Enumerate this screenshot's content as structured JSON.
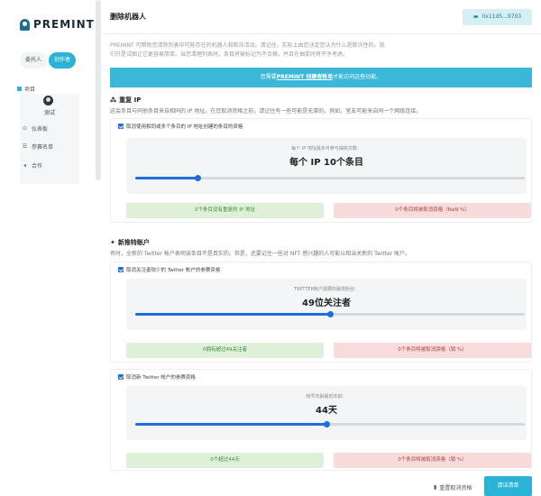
{
  "brand": {
    "name": "PREMINT"
  },
  "sidebar": {
    "role_tabs": [
      "委托人",
      "创作者"
    ],
    "projects_header": "项目",
    "project_name": "测试",
    "menu": [
      {
        "icon": "dashboard-icon",
        "label": "仪表板"
      },
      {
        "icon": "list-icon",
        "label": "参赛名单"
      },
      {
        "icon": "megaphone-icon",
        "label": "合作"
      }
    ]
  },
  "header": {
    "title": "删除机器人",
    "wallet": "0x11d5...9703"
  },
  "intro": "PREMINT 可帮助您清除列表中可能存在的机器人和欺诈活动。请记住，实际上由您决定您认为什么是欺诈性的。我们只是试图让它更容易简单。当您清理列表时，条目将被标记为不合格，并且在抽奖时将不予考虑。",
  "banner": {
    "prefix": "您需要",
    "link": "PREMINT 创建者帐单",
    "suffix": "才能访问这些功能。"
  },
  "ip_section": {
    "title": "重复 IP",
    "description": "这会条目与同他条目来自相同的 IP 地址。在您取消资格之前，请记住有一些可能是无辜的，例如，室友可能来自同一个网络连接。",
    "checkbox_label": "取消使用相同或多个条目的 IP 地址创建的条目的资格",
    "setting_label": "每个 IP 地址最多可参与抽奖次数：",
    "setting_value": "每个 IP 10个条目",
    "slider_level": 0.16,
    "stat_ok": "0个条目没有重复的 IP 地址",
    "stat_bad": "0个条目将被取消资格（NaN %）"
  },
  "twitter_section": {
    "title": "新推特账户",
    "description": "有时，全新的 Twitter 帐户表明该条目不是真实的。但是，还要记住一些对 NFT 感兴趣的人可能以相当关新的 Twitter 账户。",
    "followers": {
      "checkbox_label": "取消关注者较少的 Twitter 帐户的参赛资格",
      "setting_label": "TWITTER帐户需要的最低粉丝：",
      "setting_value": "49位关注者",
      "slider_level": 0.5,
      "stat_ok": "0拥有超过49关注者",
      "stat_bad": "0个条目将被取消资格（销 %）"
    },
    "age": {
      "checkbox_label": "取消新 Twitter 帐户的参赛资格",
      "setting_label": "帐号年龄最低年龄：",
      "setting_value": "44天",
      "slider_level": 0.49,
      "stat_ok": "0个超过44天",
      "stat_bad": "0个条目将被取消资格（销 %）"
    }
  },
  "footer": {
    "reset_label": "重置取消资格",
    "clean_label": "清洁清单"
  },
  "colors": {
    "accent": "#2bb3d6",
    "blue": "#1e6fd9",
    "green_bg": "#dff0d8",
    "red_bg": "#f8dcdc"
  }
}
